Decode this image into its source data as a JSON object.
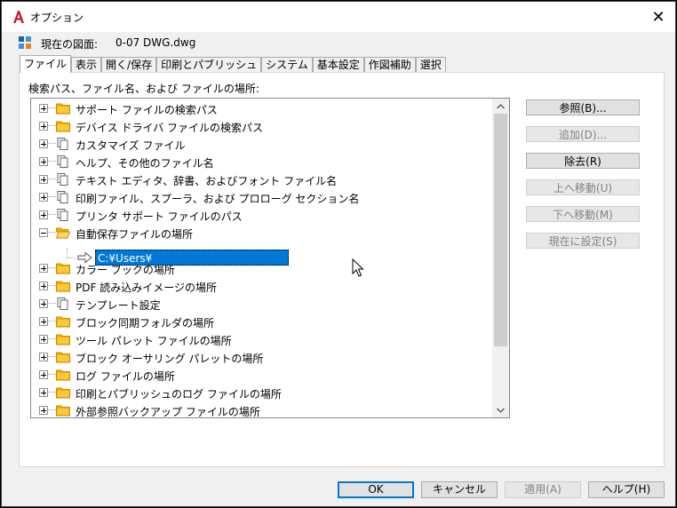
{
  "window": {
    "title": "オプション",
    "close_glyph": "✕"
  },
  "drawing": {
    "label": "現在の図面:",
    "value": "0-07 DWG.dwg"
  },
  "tabs": [
    "ファイル",
    "表示",
    "開く/保存",
    "印刷とパブリッシュ",
    "システム",
    "基本設定",
    "作図補助",
    "選択"
  ],
  "active_tab": "ファイル",
  "panel": {
    "section_label": "検索パス、ファイル名、および ファイルの場所:",
    "tree_items": [
      {
        "label": "サポート ファイルの検索パス",
        "icon": "folder-icon",
        "expanded": false
      },
      {
        "label": "デバイス ドライバ ファイルの検索パス",
        "icon": "folder-icon",
        "expanded": false
      },
      {
        "label": "カスタマイズ ファイル",
        "icon": "file-stack-icon",
        "expanded": false
      },
      {
        "label": "ヘルプ、その他のファイル名",
        "icon": "file-stack-icon",
        "expanded": false
      },
      {
        "label": "テキスト エディタ、辞書、およびフォント ファイル名",
        "icon": "file-stack-icon",
        "expanded": false
      },
      {
        "label": "印刷ファイル、スプーラ、および プロローグ セクション名",
        "icon": "file-stack-icon",
        "expanded": false
      },
      {
        "label": "プリンタ サポート ファイルのパス",
        "icon": "file-stack-icon",
        "expanded": false
      },
      {
        "label": "自動保存ファイルの場所",
        "icon": "open-folder-icon",
        "expanded": true
      },
      {
        "label": "カラー ブックの場所",
        "icon": "folder-icon",
        "expanded": false
      },
      {
        "label": "PDF 読み込みイメージの場所",
        "icon": "folder-icon",
        "expanded": false
      },
      {
        "label": "テンプレート設定",
        "icon": "file-stack-icon",
        "expanded": false
      },
      {
        "label": "ブロック同期フォルダの場所",
        "icon": "folder-icon",
        "expanded": false
      },
      {
        "label": "ツール パレット ファイルの場所",
        "icon": "folder-icon",
        "expanded": false
      },
      {
        "label": "ブロック オーサリング パレットの場所",
        "icon": "folder-icon",
        "expanded": false
      },
      {
        "label": "ログ ファイルの場所",
        "icon": "folder-icon",
        "expanded": false
      },
      {
        "label": "印刷とパブリッシュのログ ファイルの場所",
        "icon": "folder-icon",
        "expanded": false
      },
      {
        "label": "外部参照バックアップ ファイルの場所",
        "icon": "folder-icon",
        "expanded": false
      }
    ],
    "editing_path": "C:¥Users¥"
  },
  "side_buttons": [
    {
      "label": "参照(B)...",
      "enabled": true
    },
    {
      "label": "追加(D)...",
      "enabled": false
    },
    {
      "label": "除去(R)",
      "enabled": true
    },
    {
      "label": "上へ移動(U)",
      "enabled": false
    },
    {
      "label": "下へ移動(M)",
      "enabled": false
    },
    {
      "label": "現在に設定(S)",
      "enabled": false
    }
  ],
  "footer": {
    "ok": "OK",
    "cancel": "キャンセル",
    "apply": "適用(A)",
    "help": "ヘルプ(H)"
  },
  "colors": {
    "selection": "#0078d7",
    "folder": "#f0b000",
    "accent": "#0078d7"
  }
}
